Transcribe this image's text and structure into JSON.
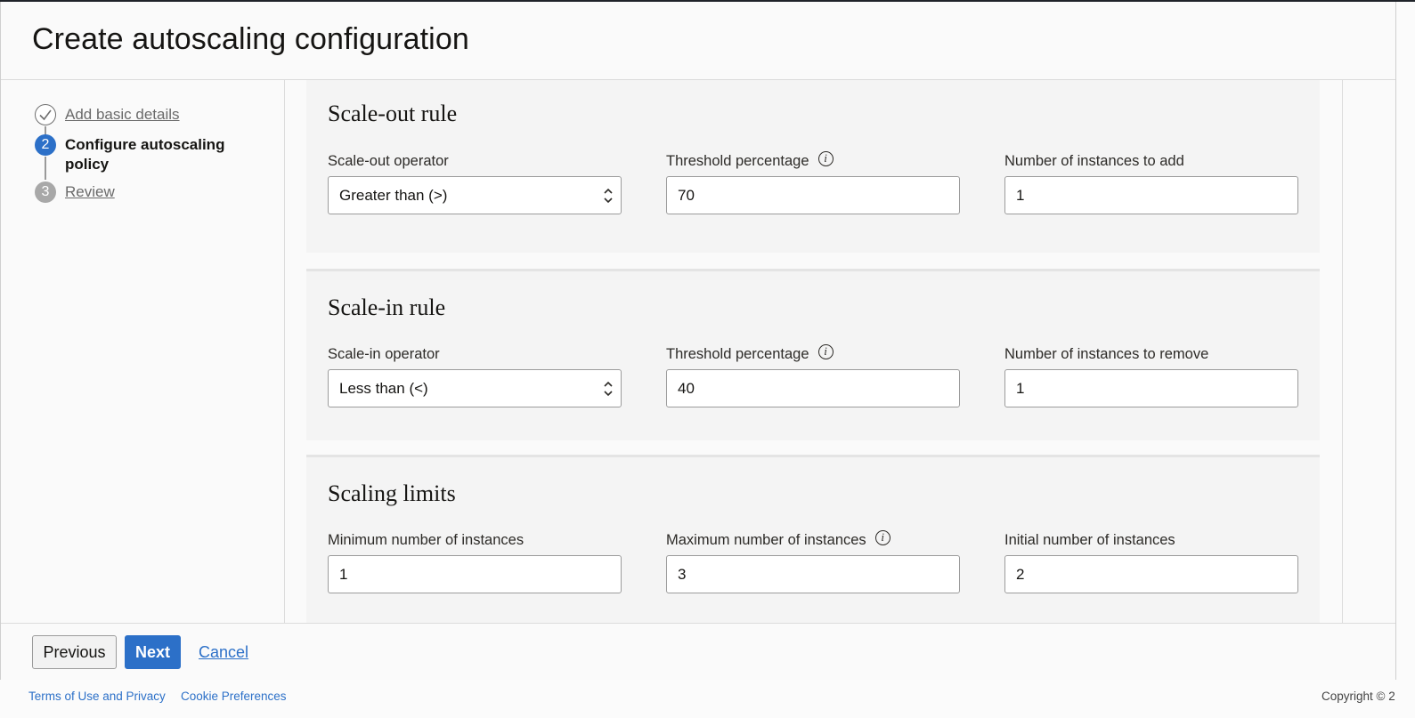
{
  "page": {
    "title": "Create autoscaling configuration"
  },
  "steps": [
    {
      "number": "",
      "label": "Add basic details",
      "state": "done"
    },
    {
      "number": "2",
      "label": "Configure autoscaling policy",
      "state": "active"
    },
    {
      "number": "3",
      "label": "Review",
      "state": "todo"
    }
  ],
  "scale_out": {
    "title": "Scale-out rule",
    "operator_label": "Scale-out operator",
    "operator_value": "Greater than (>)",
    "threshold_label": "Threshold percentage",
    "threshold_value": "70",
    "instances_label": "Number of instances to add",
    "instances_value": "1"
  },
  "scale_in": {
    "title": "Scale-in rule",
    "operator_label": "Scale-in operator",
    "operator_value": "Less than (<)",
    "threshold_label": "Threshold percentage",
    "threshold_value": "40",
    "instances_label": "Number of instances to remove",
    "instances_value": "1"
  },
  "limits": {
    "title": "Scaling limits",
    "min_label": "Minimum number of instances",
    "min_value": "1",
    "max_label": "Maximum number of instances",
    "max_value": "3",
    "initial_label": "Initial number of instances",
    "initial_value": "2"
  },
  "footer": {
    "previous_label": "Previous",
    "next_label": "Next",
    "cancel_label": "Cancel"
  },
  "page_footer": {
    "terms_label": "Terms of Use and Privacy",
    "cookie_label": "Cookie Preferences",
    "copyright": "Copyright © 2"
  },
  "icons": {
    "info": "info-icon",
    "check": "check-icon",
    "select_arrows": "chevron-up-down-icon"
  },
  "colors": {
    "accent": "#2c70c8",
    "section_bg": "#f4f4f4"
  }
}
